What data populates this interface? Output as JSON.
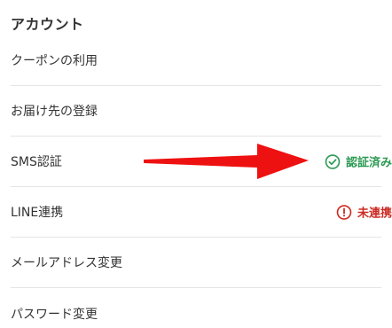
{
  "account": {
    "title": "アカウント",
    "items": [
      {
        "label": "クーポンの利用"
      },
      {
        "label": "お届け先の登録"
      },
      {
        "label": "SMS認証",
        "status": {
          "text": "認証済み",
          "icon": "check-circle-icon",
          "color": "#2b9a52"
        }
      },
      {
        "label": "LINE連携",
        "status": {
          "text": "未連携",
          "icon": "exclamation-circle-icon",
          "color": "#cc2a22"
        }
      },
      {
        "label": "メールアドレス変更"
      },
      {
        "label": "パスワード変更"
      }
    ]
  },
  "annotation": {
    "icon": "red-arrow-icon",
    "color": "#ee1111"
  }
}
